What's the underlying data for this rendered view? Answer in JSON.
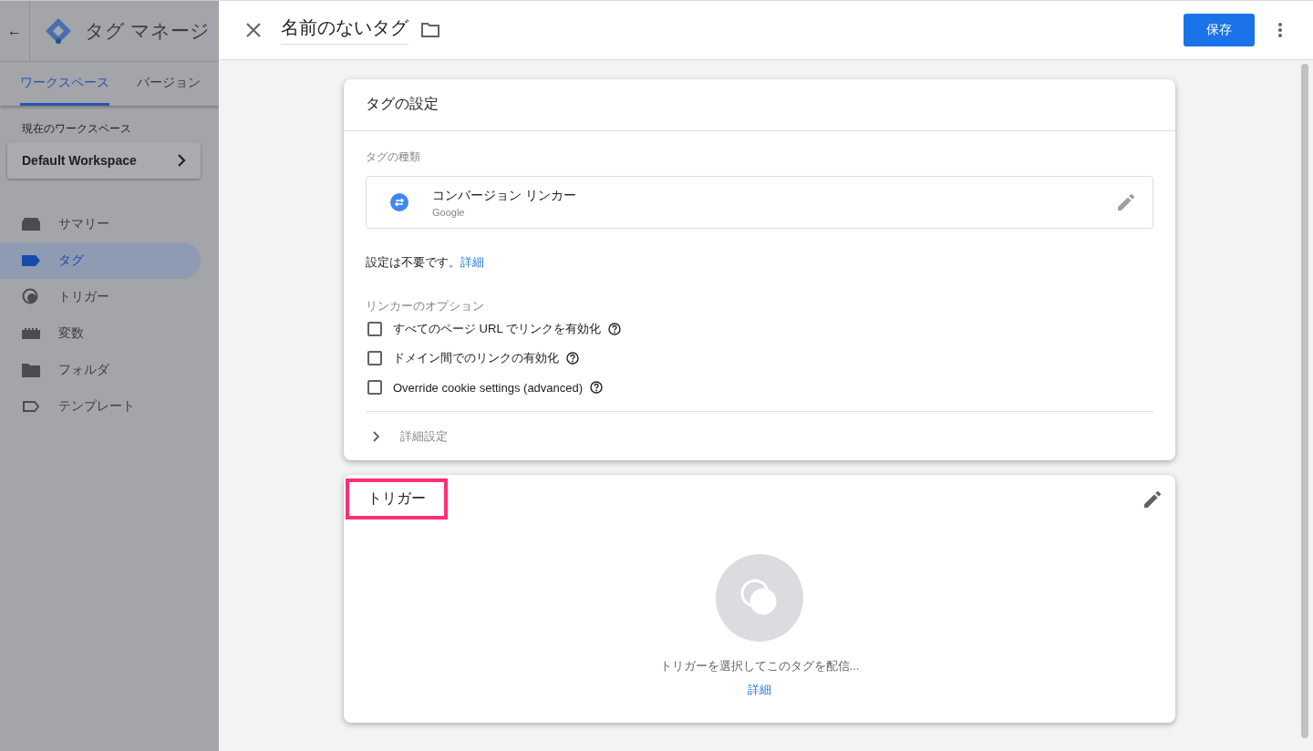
{
  "sidebar": {
    "back": "←",
    "app_title": "タグ マネージ",
    "tabs": [
      {
        "label": "ワークスペース",
        "selected": true
      },
      {
        "label": "バージョン",
        "selected": false
      }
    ],
    "workspace_label": "現在のワークスペース",
    "workspace": "Default Workspace",
    "items": [
      {
        "kind": "summary",
        "label": "サマリー",
        "selected": false
      },
      {
        "kind": "tag",
        "label": "タグ",
        "selected": true
      },
      {
        "kind": "trigger",
        "label": "トリガー",
        "selected": false
      },
      {
        "kind": "variable",
        "label": "変数",
        "selected": false
      },
      {
        "kind": "folder",
        "label": "フォルダ",
        "selected": false
      },
      {
        "kind": "template",
        "label": "テンプレート",
        "selected": false
      }
    ]
  },
  "editor": {
    "name": "名前のないタグ",
    "save": "保存",
    "tag_config": {
      "title": "タグの設定",
      "type_label": "タグの種類",
      "type_name": "コンバージョン リンカー",
      "type_vendor": "Google",
      "note": "設定は不要です。",
      "note_link": "詳細",
      "options_label": "リンカーのオプション",
      "options": [
        {
          "label": "すべてのページ URL でリンクを有効化",
          "checked": false
        },
        {
          "label": "ドメイン間でのリンクの有効化",
          "checked": false
        },
        {
          "label": "Override cookie settings (advanced)",
          "checked": false
        }
      ],
      "advanced": "詳細設定",
      "advanced_expanded": false
    },
    "trigger": {
      "title": "トリガー",
      "highlighted": true,
      "empty_text": "トリガーを選択してこのタグを配信...",
      "link": "詳細"
    }
  }
}
